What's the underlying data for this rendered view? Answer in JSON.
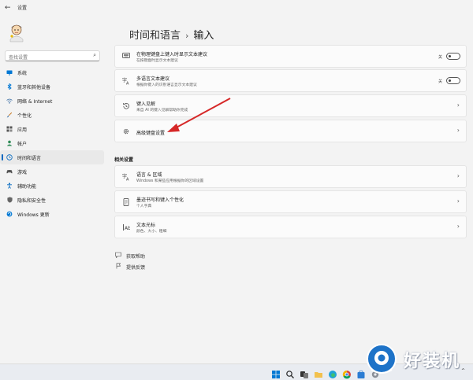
{
  "window": {
    "title": "设置",
    "back_icon": "arrow-left-icon"
  },
  "search": {
    "placeholder": "查找设置"
  },
  "nav": {
    "items": [
      {
        "label": "系统",
        "icon": "monitor-icon",
        "color": "#0078d4"
      },
      {
        "label": "蓝牙和其他设备",
        "icon": "bluetooth-icon",
        "color": "#0078d4"
      },
      {
        "label": "网络 & Internet",
        "icon": "wifi-icon",
        "color": "#3a6ea5"
      },
      {
        "label": "个性化",
        "icon": "brush-icon",
        "color": "#c87d2a"
      },
      {
        "label": "应用",
        "icon": "apps-icon",
        "color": "#555555"
      },
      {
        "label": "帐户",
        "icon": "person-icon",
        "color": "#2e8b57"
      },
      {
        "label": "时间和语言",
        "icon": "globe-clock-icon",
        "color": "#0067c0",
        "active": true
      },
      {
        "label": "游戏",
        "icon": "gamepad-icon",
        "color": "#555555"
      },
      {
        "label": "辅助功能",
        "icon": "accessibility-icon",
        "color": "#0067c0"
      },
      {
        "label": "隐私和安全性",
        "icon": "shield-icon",
        "color": "#555555"
      },
      {
        "label": "Windows 更新",
        "icon": "update-icon",
        "color": "#0078d4"
      }
    ]
  },
  "breadcrumb": {
    "parent": "时间和语言",
    "separator": "›",
    "current": "输入"
  },
  "cards": [
    {
      "title": "在物理键盘上键入时显示文本建议",
      "desc": "在按键盘时显示文本建议",
      "icon": "keyboard-icon",
      "control": "toggle",
      "state": "关"
    },
    {
      "title": "多语言文本建议",
      "desc": "根据你键入的识别语言显示文本建议",
      "icon": "multilingual-icon",
      "control": "toggle",
      "state": "关"
    },
    {
      "title": "键入见解",
      "desc": "来自 AI 的键入见解帮助你完成",
      "icon": "history-icon",
      "control": "chevron"
    },
    {
      "title": "高级键盘设置",
      "desc": "",
      "icon": "gear-icon",
      "control": "chevron"
    }
  ],
  "related": {
    "heading": "相关设置",
    "cards": [
      {
        "title": "语言 & 区域",
        "desc": "Windows 和某些应用根据你的区域设置",
        "icon": "language-icon"
      },
      {
        "title": "墨迹书写和键入个性化",
        "desc": "个人字典",
        "icon": "ink-icon"
      },
      {
        "title": "文本光标",
        "desc": "颜色、大小、粗细",
        "icon": "text-cursor-icon"
      }
    ]
  },
  "help": {
    "get_help": "获取帮助",
    "feedback": "提供反馈"
  },
  "taskbar": {
    "icons": [
      "windows-start-icon",
      "search-icon",
      "task-view-icon",
      "explorer-icon",
      "edge-icon",
      "chrome-icon",
      "store-icon",
      "settings-icon"
    ],
    "tray": "^"
  },
  "watermark": {
    "text": "好装机"
  },
  "colors": {
    "accent": "#0067c0",
    "annotation_arrow": "#d62828"
  }
}
